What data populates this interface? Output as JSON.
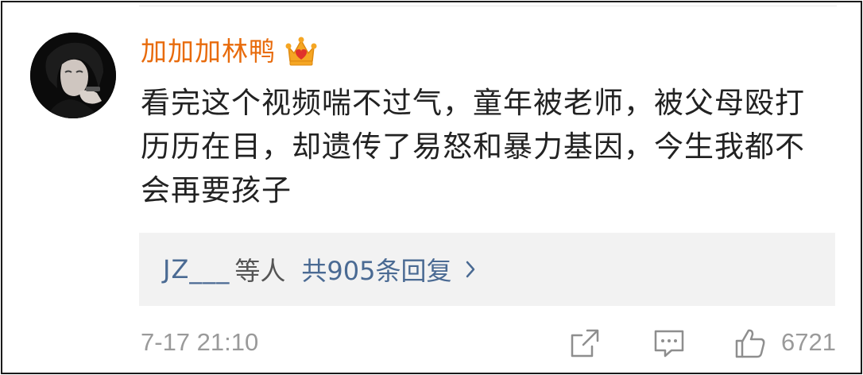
{
  "comment": {
    "username": "加加加林鸭",
    "badge_icon": "crown-icon",
    "text": "看完这个视频喘不过气，童年被老师，被父母殴打历历在目，却遗传了易怒和暴力基因，今生我都不会再要孩子"
  },
  "replies": {
    "user": "JZ___",
    "suffix": "等人",
    "count_text": "共905条回复",
    "chevron_icon": "chevron-right-icon"
  },
  "footer": {
    "timestamp": "7-17 21:10",
    "share_icon": "share-icon",
    "comment_icon": "comment-icon",
    "like_icon": "thumbs-up-icon",
    "like_count": "6721"
  },
  "colors": {
    "username": "#e86b0c",
    "reply_link": "#4a6a93",
    "meta_gray": "#9a9a9a",
    "reply_bg": "#f2f2f2",
    "crown_orange": "#f5a623",
    "crown_red": "#e0332b"
  }
}
